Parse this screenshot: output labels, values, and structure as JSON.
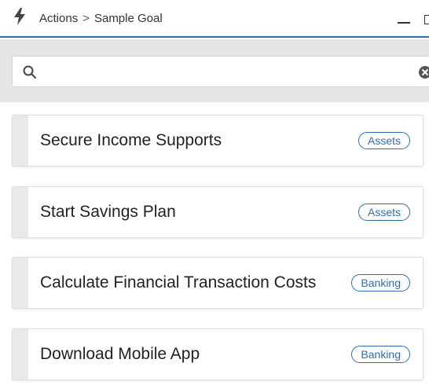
{
  "header": {
    "breadcrumb": {
      "root": "Actions",
      "separator": ">",
      "current": "Sample Goal"
    },
    "icons": {
      "app": "lightning-bolt-icon",
      "minimize": "minimize-icon",
      "maximize": "maximize-icon"
    }
  },
  "search": {
    "value": "",
    "placeholder": "",
    "icons": {
      "search": "search-icon",
      "clear": "clear-icon"
    }
  },
  "actions": [
    {
      "title": "Secure Income Supports",
      "tag": "Assets"
    },
    {
      "title": "Start Savings Plan",
      "tag": "Assets"
    },
    {
      "title": "Calculate Financial Transaction Costs",
      "tag": "Banking"
    },
    {
      "title": "Download Mobile App",
      "tag": "Banking"
    }
  ],
  "colors": {
    "accent": "#2e6db4",
    "search_band": "#e6e6e6",
    "card_stripe": "#e9e9e9"
  }
}
